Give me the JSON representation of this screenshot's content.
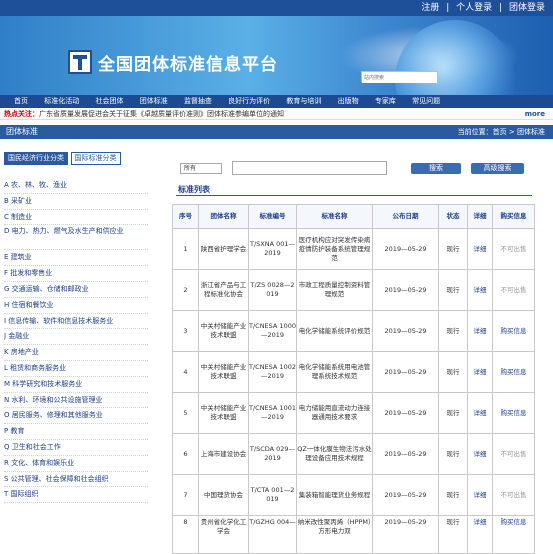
{
  "topbar": {
    "register": "注册",
    "personal_login": "个人登录",
    "group_login": "团体登录",
    "sep": "|"
  },
  "banner": {
    "title": "全国团体标准信息平台",
    "search_placeholder": "站内搜索"
  },
  "nav": [
    "首页",
    "标准化活动",
    "社会团体",
    "团体标准",
    "监督抽查",
    "良好行为评价",
    "教育与培训",
    "出版物",
    "专家库",
    "常见问题"
  ],
  "hot": {
    "label": "热点关注：",
    "text": "广东省质量发展促进会关于征集《卓越质量评价准则》团体标准参编单位的通知",
    "more": "more"
  },
  "section": {
    "title": "团体标准",
    "crumb": "当前位置：首页 > 团体标准"
  },
  "tabs": {
    "tab1": "国民经济行业分类",
    "tab2": "国际标准分类"
  },
  "categories": [
    "A 农、林、牧、渔业",
    "B 采矿业",
    "C 制造业",
    "D 电力、热力、燃气及水生产和供应业",
    "E 建筑业",
    "F 批发和零售业",
    "G 交通运输、仓储和邮政业",
    "H 住宿和餐饮业",
    "I 信息传输、软件和信息技术服务业",
    "J 金融业",
    "K 房地产业",
    "L 租赁和商务服务业",
    "M 科学研究和技术服务业",
    "N 水利、环境和公共设施管理业",
    "O 居民服务、修理和其他服务业",
    "P 教育",
    "Q 卫生和社会工作",
    "R 文化、体育和娱乐业",
    "S 公共管理、社会保障和社会组织",
    "T 国际组织"
  ],
  "filter": {
    "select_value": "所有",
    "search_button": "搜索",
    "advanced_button": "高级搜索"
  },
  "list": {
    "title": "标准列表",
    "headers": [
      "序号",
      "团体名称",
      "标准编号",
      "标准名称",
      "公布日期",
      "状态",
      "详细",
      "购买信息"
    ],
    "rows": [
      {
        "no": "1",
        "org": "陕西省护理学会",
        "code": "T/SXNA 001—2019",
        "name": "医疗机构应对突发传染病疫情防护装备系统管理规范",
        "date": "2019—05-29",
        "status": "现行",
        "detail": "详细",
        "buy": "不可出售"
      },
      {
        "no": "2",
        "org": "浙江省产品与工程标准化协会",
        "code": "T/ZS 0028—2019",
        "name": "市政工程质量控制资料管理规范",
        "date": "2019—05-29",
        "status": "现行",
        "detail": "详细",
        "buy": "不可出售"
      },
      {
        "no": "3",
        "org": "中关村储能产业技术联盟",
        "code": "T/CNESA 1000—2019",
        "name": "电化学储能系统评价规范",
        "date": "2019—05-29",
        "status": "现行",
        "detail": "详细",
        "buy": "购买信息"
      },
      {
        "no": "4",
        "org": "中关村储能产业技术联盟",
        "code": "T/CNESA 1002—2019",
        "name": "电化学储能系统用电池管理系统技术规范",
        "date": "2019—05-29",
        "status": "现行",
        "detail": "详细",
        "buy": "购买信息"
      },
      {
        "no": "5",
        "org": "中关村储能产业技术联盟",
        "code": "T/CNESA 1001—2019",
        "name": "电力储能用直流动力连接器通用技术要求",
        "date": "2019—05-29",
        "status": "现行",
        "detail": "详细",
        "buy": "购买信息"
      },
      {
        "no": "6",
        "org": "上海市建设协会",
        "code": "T/SCDA 029—2019",
        "name": "QZ一体化膜生物法污水处理设备应用技术规程",
        "date": "2019—05-29",
        "status": "现行",
        "detail": "详细",
        "buy": "不可出售"
      },
      {
        "no": "7",
        "org": "中国理货协会",
        "code": "T/CTA 001—2019",
        "name": "集装箱智能理货业务规程",
        "date": "2019—05-29",
        "status": "现行",
        "detail": "详细",
        "buy": "不可出售"
      },
      {
        "no": "8",
        "org": "贵州省化学化工学会",
        "code": "T/GZHG 004—",
        "name": "纳米改性聚丙烯（HPPM）方形电力双",
        "date": "2019—05-29",
        "status": "现行",
        "detail": "详细",
        "buy": "购买信息"
      }
    ]
  },
  "colors": {
    "nav": "#1d4a93",
    "section": "#2a5aa0",
    "link": "#1e3f8c",
    "hot": "#cc0000"
  }
}
